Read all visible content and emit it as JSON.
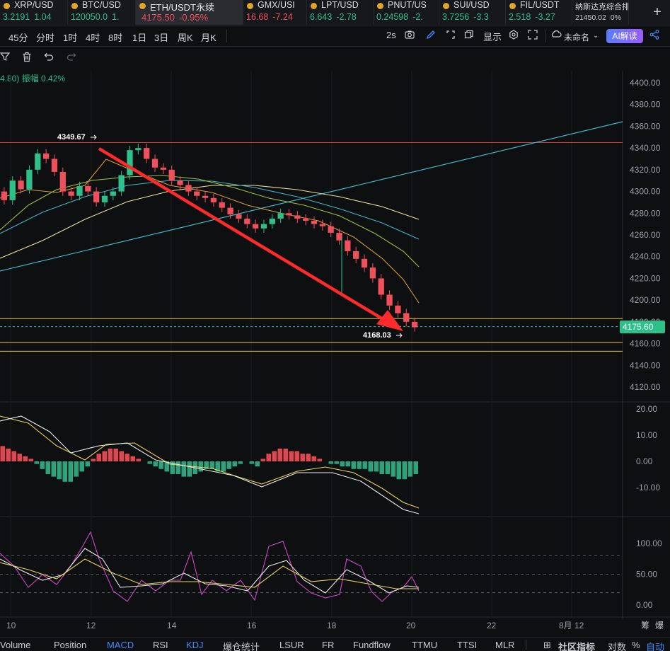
{
  "tickers": [
    {
      "symbol": "XRP/USD",
      "price": "3.2191",
      "change": "1.04",
      "dir": "up"
    },
    {
      "symbol": "BTC/USD",
      "price": "120050.0",
      "change": "1.",
      "dir": "up"
    },
    {
      "symbol": "ETH/USDT永续",
      "price": "4175.50",
      "change": "-0.95%",
      "dir": "down",
      "active": true
    },
    {
      "symbol": "GMX/USI",
      "price": "16.68",
      "change": "-7.24",
      "dir": "down"
    },
    {
      "symbol": "LPT/USD",
      "price": "6.643",
      "change": "-2.78",
      "dir": "up"
    },
    {
      "symbol": "PNUT/US",
      "price": "0.24598",
      "change": "-2.",
      "dir": "up"
    },
    {
      "symbol": "SUI/USD",
      "price": "3.7256",
      "change": "-3.3",
      "dir": "up"
    },
    {
      "symbol": "FIL/USDT",
      "price": "2.518",
      "change": "-3.27",
      "dir": "up"
    },
    {
      "symbol": "纳斯达克综合排",
      "price": "21450.02",
      "change": "0%",
      "dir": "flat"
    }
  ],
  "intervals": [
    "45分",
    "分时",
    "1时",
    "4时",
    "8时",
    "1日",
    "3日",
    "周K",
    "月K"
  ],
  "toolbar": {
    "refresh": "2s",
    "display_label": "显示",
    "layout_name": "未命名",
    "ai_label": "AI解读"
  },
  "amplitude": {
    "prefix": "4.80)",
    "label": "振幅 0.42%"
  },
  "price_axis": [
    "4400.00",
    "4380.00",
    "4360.00",
    "4340.00",
    "4320.00",
    "4300.00",
    "4280.00",
    "4260.00",
    "4240.00",
    "4220.00",
    "4200.00",
    "4180.00",
    "4160.00",
    "4140.00",
    "4120.00"
  ],
  "current_price": "4175.60",
  "annotations": {
    "high": "4349.67",
    "low": "4168.03"
  },
  "macd_axis": [
    "20.00",
    "10.00",
    "0.00",
    "-10.00"
  ],
  "kdj_axis": [
    "100.00",
    "50.00",
    "0.00"
  ],
  "time_axis": [
    "10",
    "12",
    "14",
    "16",
    "18",
    "20",
    "22",
    "8月 12"
  ],
  "time_axis_right": [
    "筹",
    "爆"
  ],
  "bottom_tabs": [
    "Volume",
    "Position",
    "MACD",
    "RSI",
    "KDJ",
    "爆仓统计",
    "LSUR",
    "FR",
    "Fundflow",
    "TTMU",
    "TTSI",
    "MLR"
  ],
  "bottom_selected": [
    "MACD",
    "KDJ"
  ],
  "bottom_right": {
    "community": "社区指标",
    "log": "对数",
    "percent": "%",
    "auto": "自动"
  },
  "colors": {
    "up": "#2ec08b",
    "down": "#f0505c",
    "arrow": "#ff2a2a",
    "trendline": "#3fb6c8",
    "resistance": "#e03a3a",
    "support": "#e6c64a",
    "accent": "#3f8cff"
  },
  "chart_data": {
    "type": "line",
    "ylim": [
      4110,
      4410
    ],
    "series": [
      {
        "name": "",
        "values": []
      }
    ],
    "candles_close_approx": [
      4292,
      4310,
      4302,
      4320,
      4335,
      4330,
      4318,
      4300,
      4296,
      4305,
      4300,
      4290,
      4296,
      4300,
      4315,
      4338,
      4340,
      4330,
      4322,
      4320,
      4310,
      4306,
      4300,
      4296,
      4294,
      4290,
      4285,
      4279,
      4275,
      4270,
      4266,
      4270,
      4275,
      4280,
      4278,
      4275,
      4273,
      4270,
      4268,
      4262,
      4255,
      4245,
      4238,
      4230,
      4220,
      4205,
      4195,
      4188,
      4180,
      4175
    ],
    "horizontal_levels": [
      4345,
      4183,
      4163,
      4153
    ]
  }
}
